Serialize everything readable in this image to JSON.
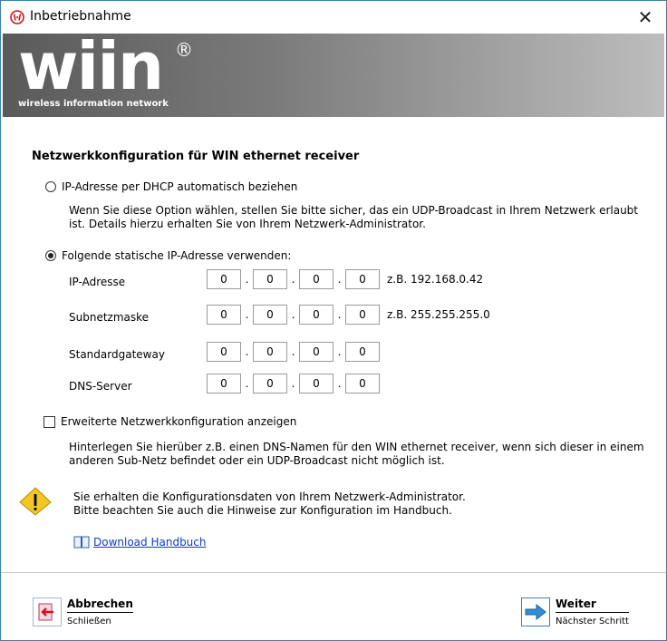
{
  "window": {
    "title": "Inbetriebnahme",
    "close_glyph": "✕"
  },
  "banner": {
    "logo": "wiin",
    "registered": "®",
    "tagline": "wireless information network"
  },
  "config": {
    "heading": "Netzwerkkonfiguration für WIN ethernet receiver",
    "dhcp": {
      "label": "IP-Adresse per DHCP automatisch beziehen",
      "checked": false,
      "hint_line1": "Wenn Sie diese Option wählen, stellen Sie bitte sicher, das ein UDP-Broadcast in Ihrem Netzwerk erlaubt",
      "hint_line2": "ist. Details hierzu erhalten Sie von Ihrem Netzwerk-Administrator."
    },
    "static": {
      "label": "Folgende statische IP-Adresse verwenden:",
      "checked": true
    },
    "fields": [
      {
        "label": "IP-Adresse",
        "octets": [
          "0",
          "0",
          "0",
          "0"
        ],
        "example": "z.B. 192.168.0.42"
      },
      {
        "label": "Subnetzmaske",
        "octets": [
          "0",
          "0",
          "0",
          "0"
        ],
        "example": "z.B. 255.255.255.0"
      },
      {
        "label": "Standardgateway",
        "octets": [
          "0",
          "0",
          "0",
          "0"
        ],
        "example": ""
      },
      {
        "label": "DNS-Server",
        "octets": [
          "0",
          "0",
          "0",
          "0"
        ],
        "example": ""
      }
    ],
    "extended": {
      "label": "Erweiterte Netzwerkkonfiguration anzeigen",
      "checked": false,
      "hint_line1": "Hinterlegen Sie hierüber z.B. einen DNS-Namen für den WIN ethernet receiver, wenn sich dieser in einem",
      "hint_line2": "anderen Sub-Netz befindet oder ein UDP-Broadcast nicht möglich ist."
    }
  },
  "notice": {
    "icon": "warning-icon",
    "line1": "Sie erhalten die Konfigurationsdaten von Ihrem Netzwerk-Administrator.",
    "line2": "Bitte beachten Sie auch die Hinweise zur Konfiguration im Handbuch.",
    "link_icon": "book-icon",
    "link_label": "Download Handbuch"
  },
  "footer": {
    "cancel": {
      "label": "Abbrechen",
      "sub": "Schließen",
      "icon": "exit-icon"
    },
    "next": {
      "label": "Weiter",
      "sub": "Nächster Schritt",
      "icon": "arrow-right-icon"
    }
  },
  "colors": {
    "accent": "#3c7fb1",
    "link": "#0b3ec8",
    "warning": "#f3c623"
  }
}
